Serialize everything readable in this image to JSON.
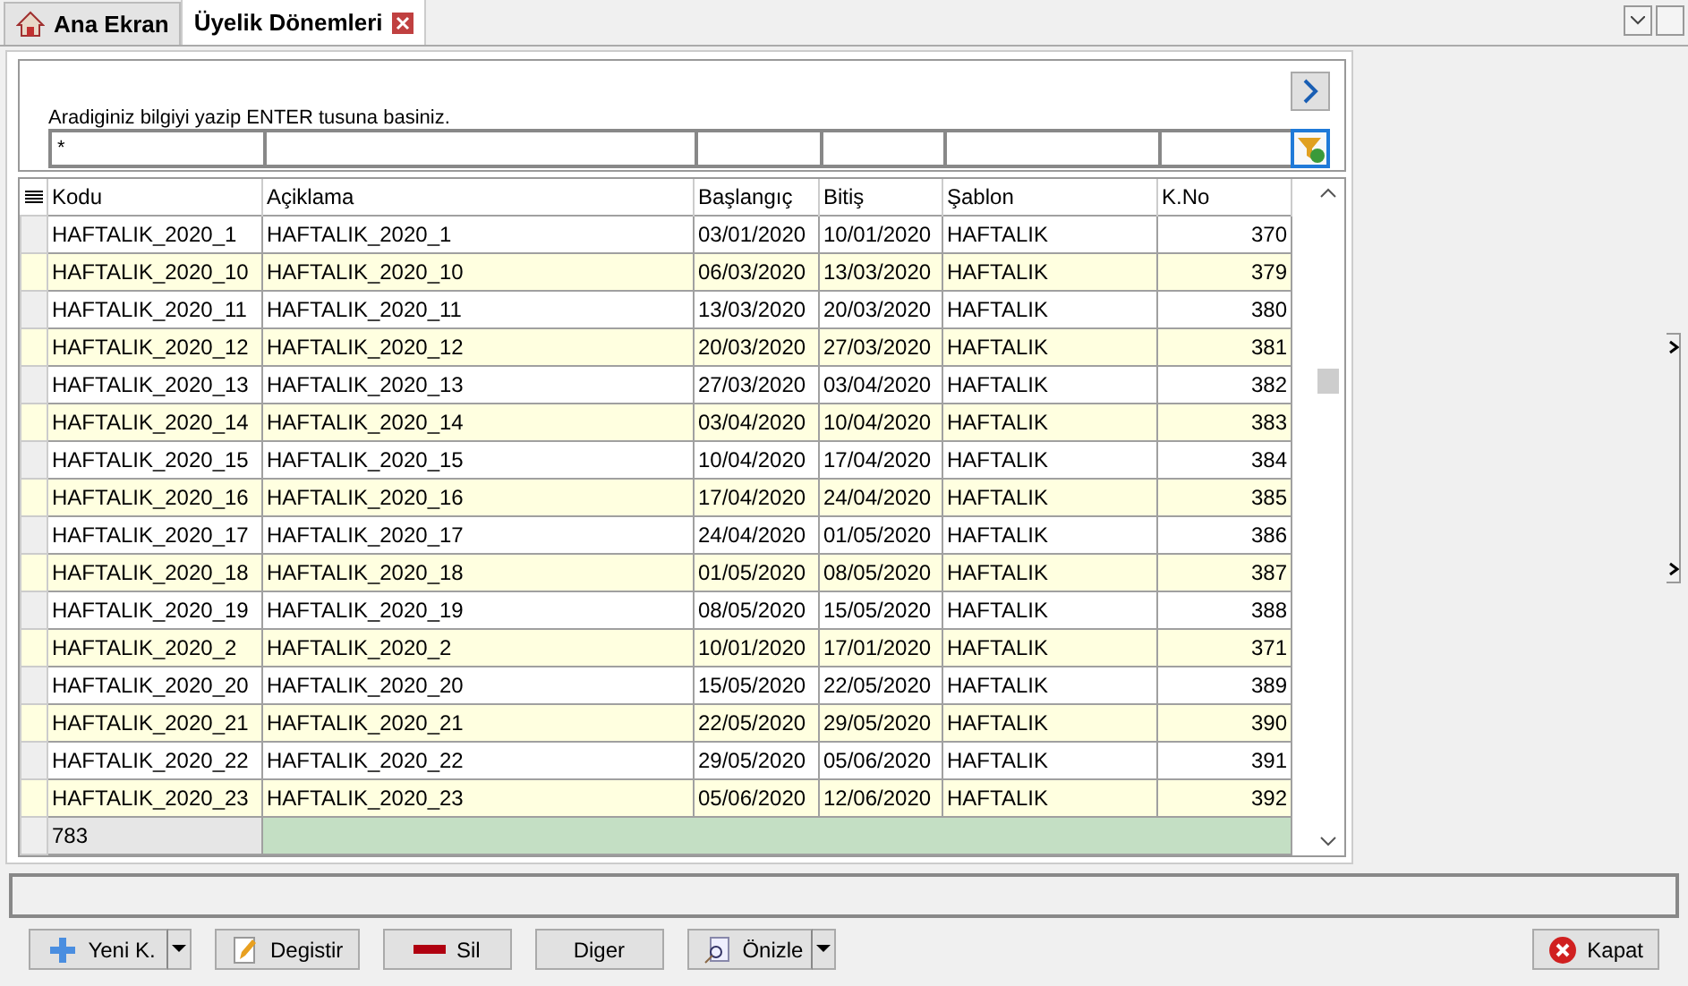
{
  "tabs": [
    {
      "label": "Ana Ekran",
      "kind": "home",
      "selected": false
    },
    {
      "label": "Üyelik Dönemleri",
      "kind": "closable",
      "selected": true
    }
  ],
  "search": {
    "hint": "Aradiginiz bilgiyi yazip ENTER tusuna basiniz.",
    "first_filter_value": "*"
  },
  "table": {
    "columns": [
      "Kodu",
      "Açiklama",
      "Başlangıç",
      "Bitiş",
      "Şablon",
      "K.No"
    ],
    "rows": [
      [
        "HAFTALIK_2020_1",
        "HAFTALIK_2020_1",
        "03/01/2020",
        "10/01/2020",
        "HAFTALIK",
        "370"
      ],
      [
        "HAFTALIK_2020_10",
        "HAFTALIK_2020_10",
        "06/03/2020",
        "13/03/2020",
        "HAFTALIK",
        "379"
      ],
      [
        "HAFTALIK_2020_11",
        "HAFTALIK_2020_11",
        "13/03/2020",
        "20/03/2020",
        "HAFTALIK",
        "380"
      ],
      [
        "HAFTALIK_2020_12",
        "HAFTALIK_2020_12",
        "20/03/2020",
        "27/03/2020",
        "HAFTALIK",
        "381"
      ],
      [
        "HAFTALIK_2020_13",
        "HAFTALIK_2020_13",
        "27/03/2020",
        "03/04/2020",
        "HAFTALIK",
        "382"
      ],
      [
        "HAFTALIK_2020_14",
        "HAFTALIK_2020_14",
        "03/04/2020",
        "10/04/2020",
        "HAFTALIK",
        "383"
      ],
      [
        "HAFTALIK_2020_15",
        "HAFTALIK_2020_15",
        "10/04/2020",
        "17/04/2020",
        "HAFTALIK",
        "384"
      ],
      [
        "HAFTALIK_2020_16",
        "HAFTALIK_2020_16",
        "17/04/2020",
        "24/04/2020",
        "HAFTALIK",
        "385"
      ],
      [
        "HAFTALIK_2020_17",
        "HAFTALIK_2020_17",
        "24/04/2020",
        "01/05/2020",
        "HAFTALIK",
        "386"
      ],
      [
        "HAFTALIK_2020_18",
        "HAFTALIK_2020_18",
        "01/05/2020",
        "08/05/2020",
        "HAFTALIK",
        "387"
      ],
      [
        "HAFTALIK_2020_19",
        "HAFTALIK_2020_19",
        "08/05/2020",
        "15/05/2020",
        "HAFTALIK",
        "388"
      ],
      [
        "HAFTALIK_2020_2",
        "HAFTALIK_2020_2",
        "10/01/2020",
        "17/01/2020",
        "HAFTALIK",
        "371"
      ],
      [
        "HAFTALIK_2020_20",
        "HAFTALIK_2020_20",
        "15/05/2020",
        "22/05/2020",
        "HAFTALIK",
        "389"
      ],
      [
        "HAFTALIK_2020_21",
        "HAFTALIK_2020_21",
        "22/05/2020",
        "29/05/2020",
        "HAFTALIK",
        "390"
      ],
      [
        "HAFTALIK_2020_22",
        "HAFTALIK_2020_22",
        "29/05/2020",
        "05/06/2020",
        "HAFTALIK",
        "391"
      ],
      [
        "HAFTALIK_2020_23",
        "HAFTALIK_2020_23",
        "05/06/2020",
        "12/06/2020",
        "HAFTALIK",
        "392"
      ]
    ],
    "footer_count": "783"
  },
  "buttons": [
    {
      "label": "Yeni K.",
      "kind": "add",
      "dropdown": true
    },
    {
      "label": "Degistir",
      "kind": "edit",
      "dropdown": false
    },
    {
      "label": "Sil",
      "kind": "delete",
      "dropdown": false
    },
    {
      "label": "Diger",
      "kind": "plain",
      "dropdown": false
    },
    {
      "label": "Önizle",
      "kind": "preview",
      "dropdown": true
    }
  ],
  "close_button": {
    "label": "Kapat"
  }
}
